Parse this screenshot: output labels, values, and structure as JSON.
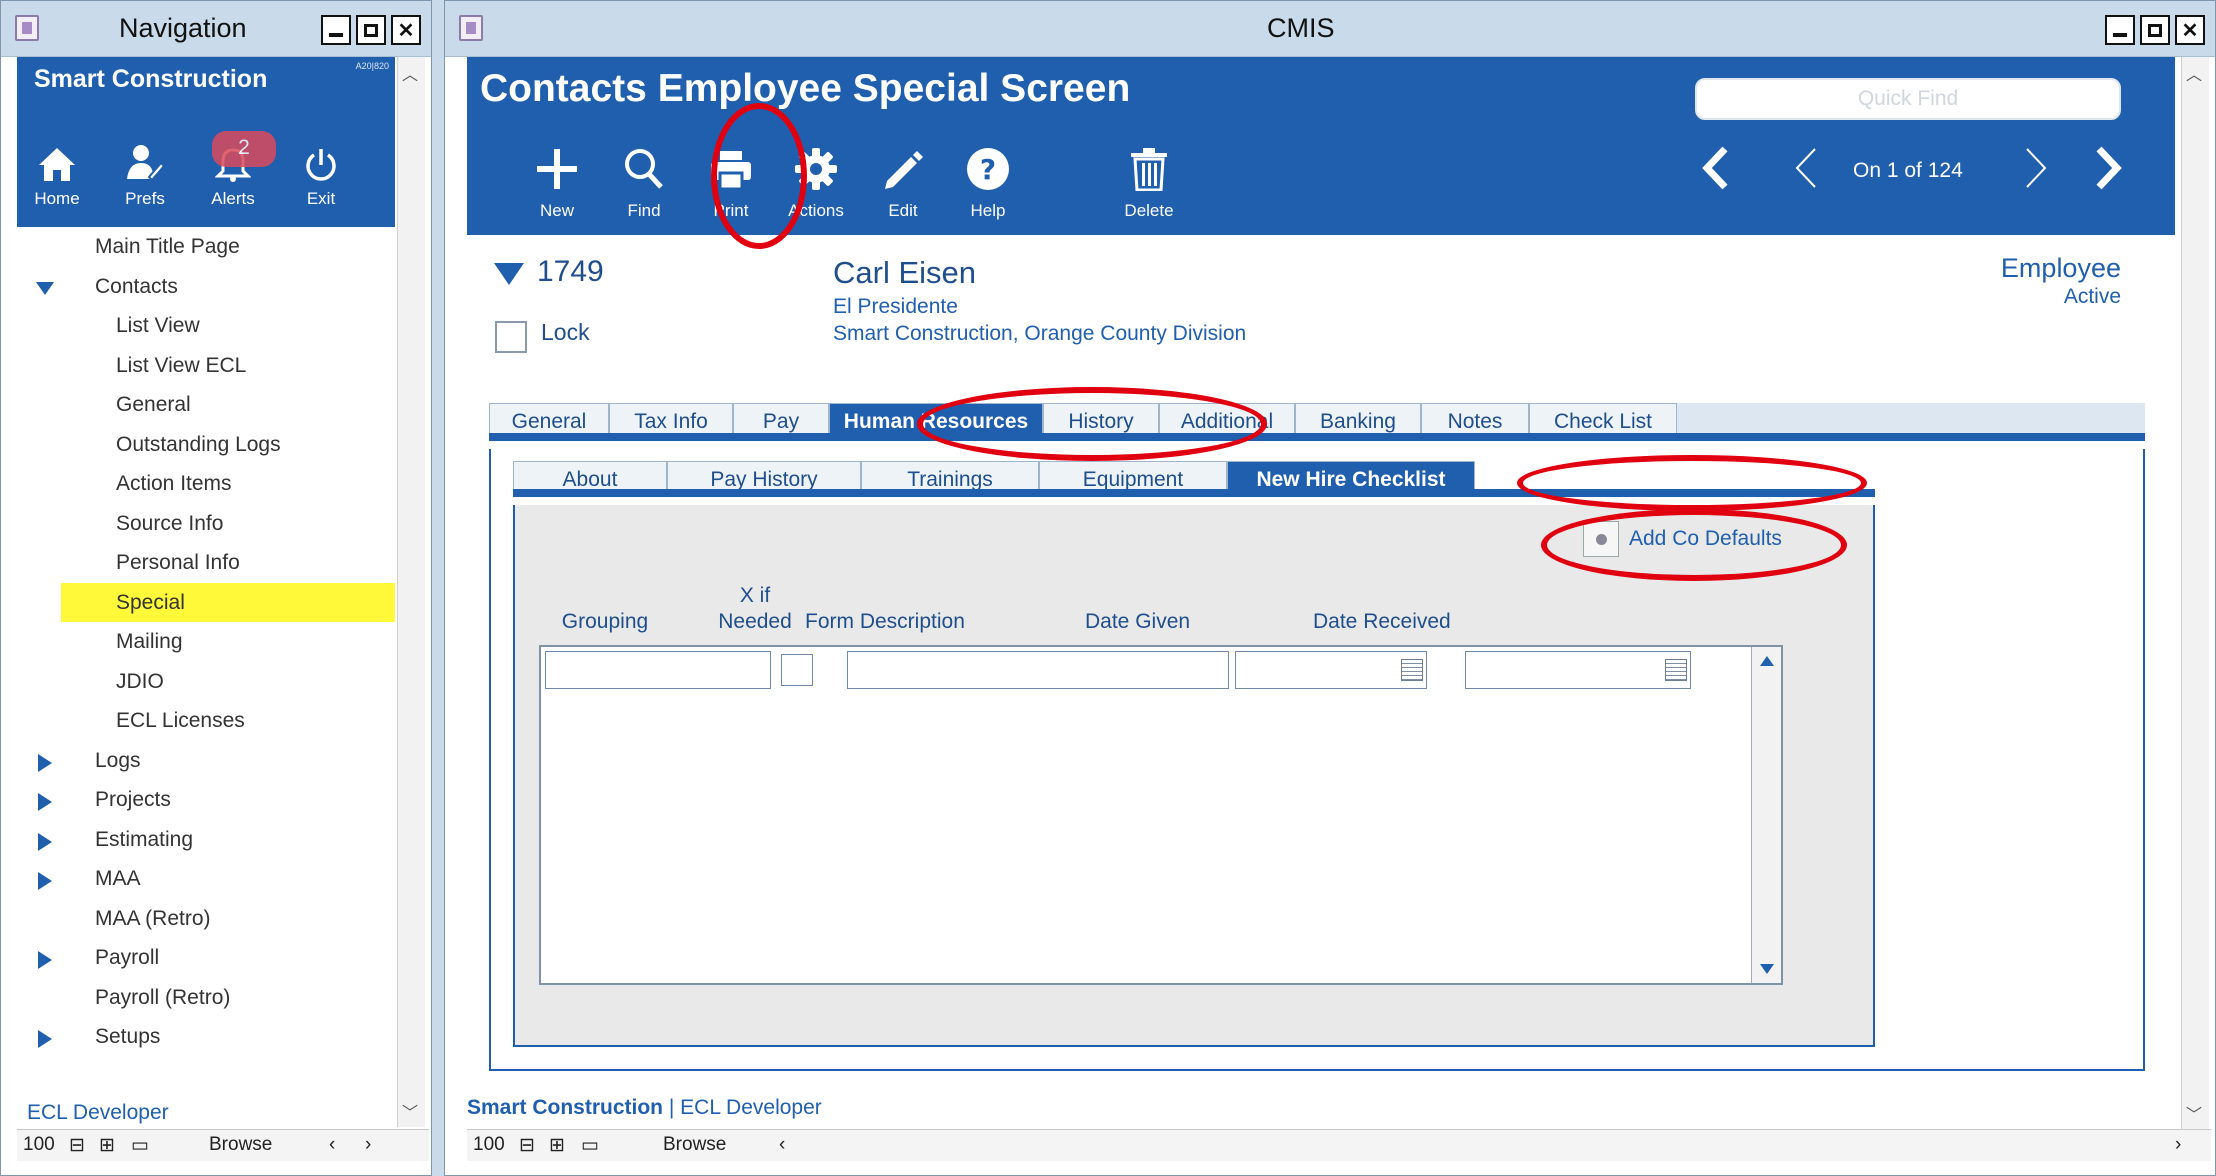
{
  "nav": {
    "window_title": "Navigation",
    "brand": "Smart Construction",
    "version": "A20|820",
    "buttons": [
      {
        "label": "Home",
        "icon": "home-icon"
      },
      {
        "label": "Prefs",
        "icon": "prefs-icon"
      },
      {
        "label": "Alerts",
        "icon": "bell-icon"
      },
      {
        "label": "Exit",
        "icon": "power-icon"
      }
    ],
    "alerts_count": "2",
    "items": [
      {
        "label": "Main Title Page",
        "level": 1,
        "toggle": "none"
      },
      {
        "label": "Contacts",
        "level": 1,
        "toggle": "expanded"
      },
      {
        "label": "List View",
        "level": 2,
        "toggle": "none"
      },
      {
        "label": "List View ECL",
        "level": 2,
        "toggle": "none"
      },
      {
        "label": "General",
        "level": 2,
        "toggle": "none"
      },
      {
        "label": "Outstanding Logs",
        "level": 2,
        "toggle": "none"
      },
      {
        "label": "Action Items",
        "level": 2,
        "toggle": "none"
      },
      {
        "label": "Source Info",
        "level": 2,
        "toggle": "none"
      },
      {
        "label": "Personal Info",
        "level": 2,
        "toggle": "none"
      },
      {
        "label": "Special",
        "level": 2,
        "toggle": "none",
        "selected": true
      },
      {
        "label": "Mailing",
        "level": 2,
        "toggle": "none"
      },
      {
        "label": "JDIO",
        "level": 2,
        "toggle": "none"
      },
      {
        "label": "ECL Licenses",
        "level": 2,
        "toggle": "none"
      },
      {
        "label": "Logs",
        "level": 1,
        "toggle": "collapsed"
      },
      {
        "label": "Projects",
        "level": 1,
        "toggle": "collapsed"
      },
      {
        "label": "Estimating",
        "level": 1,
        "toggle": "collapsed"
      },
      {
        "label": "MAA",
        "level": 1,
        "toggle": "collapsed"
      },
      {
        "label": "MAA (Retro)",
        "level": 1,
        "toggle": "none"
      },
      {
        "label": "Payroll",
        "level": 1,
        "toggle": "collapsed"
      },
      {
        "label": "Payroll (Retro)",
        "level": 1,
        "toggle": "none"
      },
      {
        "label": "Setups",
        "level": 1,
        "toggle": "collapsed"
      }
    ],
    "footer": "ECL Developer",
    "status": {
      "zoom": "100",
      "mode": "Browse"
    }
  },
  "main": {
    "window_title": "CMIS",
    "screen_title": "Contacts Employee Special Screen",
    "quick_find_placeholder": "Quick Find",
    "toolbar": [
      {
        "label": "New",
        "icon": "plus-icon"
      },
      {
        "label": "Find",
        "icon": "search-icon"
      },
      {
        "label": "Print",
        "icon": "printer-icon"
      },
      {
        "label": "Actions",
        "icon": "gear-icon"
      },
      {
        "label": "Edit",
        "icon": "pencil-icon"
      },
      {
        "label": "Help",
        "icon": "help-icon"
      },
      {
        "label": "Delete",
        "icon": "trash-icon"
      }
    ],
    "record_position": "On 1 of 124",
    "record": {
      "id": "1749",
      "lock_label": "Lock",
      "name": "Carl Eisen",
      "job_title": "El Presidente",
      "organization": "Smart Construction, Orange County Division",
      "type": "Employee",
      "status": "Active"
    },
    "tabs": [
      "General",
      "Tax Info",
      "Pay",
      "Human Resources",
      "History",
      "Additional",
      "Banking",
      "Notes",
      "Check List"
    ],
    "active_tab": "Human Resources",
    "subtabs": [
      "About",
      "Pay History",
      "Trainings",
      "Equipment",
      "New Hire Checklist"
    ],
    "active_subtab": "New Hire Checklist",
    "add_defaults_label": "Add Co Defaults",
    "columns": {
      "grouping": "Grouping",
      "x_if_line1": "X if",
      "x_if_line2": "Needed",
      "form_description": "Form Description",
      "date_given": "Date Given",
      "date_received": "Date Received"
    },
    "footer_org": "Smart Construction",
    "footer_sep": " | ",
    "footer_user": "ECL Developer",
    "status": {
      "zoom": "100",
      "mode": "Browse"
    }
  },
  "annotation_color": "#e10010",
  "accent_color": "#1f5fae",
  "highlight_color": "#fff93a"
}
